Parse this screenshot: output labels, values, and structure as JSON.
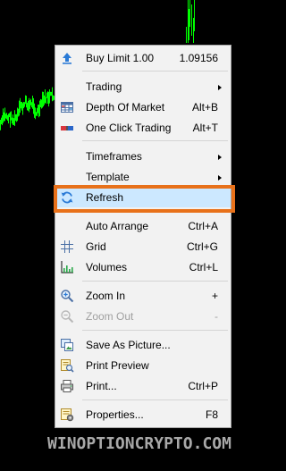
{
  "menu": {
    "items": [
      {
        "label": "Buy Limit 1.00",
        "shortcut": "1.09156",
        "icon": "buy-limit-icon",
        "submenu": false
      },
      {
        "label": "Trading",
        "shortcut": "",
        "icon": "",
        "submenu": true
      },
      {
        "label": "Depth Of Market",
        "shortcut": "Alt+B",
        "icon": "depth-of-market-icon",
        "submenu": false
      },
      {
        "label": "One Click Trading",
        "shortcut": "Alt+T",
        "icon": "one-click-trading-icon",
        "submenu": false
      },
      {
        "label": "Timeframes",
        "shortcut": "",
        "icon": "",
        "submenu": true
      },
      {
        "label": "Template",
        "shortcut": "",
        "icon": "",
        "submenu": true
      },
      {
        "label": "Refresh",
        "shortcut": "",
        "icon": "refresh-icon",
        "submenu": false
      },
      {
        "label": "Auto Arrange",
        "shortcut": "Ctrl+A",
        "icon": "",
        "submenu": false
      },
      {
        "label": "Grid",
        "shortcut": "Ctrl+G",
        "icon": "grid-icon",
        "submenu": false
      },
      {
        "label": "Volumes",
        "shortcut": "Ctrl+L",
        "icon": "volumes-icon",
        "submenu": false
      },
      {
        "label": "Zoom In",
        "shortcut": "+",
        "icon": "zoom-in-icon",
        "submenu": false
      },
      {
        "label": "Zoom Out",
        "shortcut": "-",
        "icon": "zoom-out-icon",
        "submenu": false,
        "disabled": true
      },
      {
        "label": "Save As Picture...",
        "shortcut": "",
        "icon": "save-picture-icon",
        "submenu": false
      },
      {
        "label": "Print Preview",
        "shortcut": "",
        "icon": "print-preview-icon",
        "submenu": false
      },
      {
        "label": "Print...",
        "shortcut": "Ctrl+P",
        "icon": "print-icon",
        "submenu": false
      },
      {
        "label": "Properties...",
        "shortcut": "F8",
        "icon": "properties-icon",
        "submenu": false
      }
    ],
    "highlighted": "Refresh"
  },
  "colors": {
    "chart_background": "#000000",
    "candles": "#00ff00",
    "menu_background": "#f2f2f2",
    "highlight": "#cce8ff",
    "callout_border": "#e8711a",
    "watermark": "#a8a8a8"
  },
  "watermark": "WINOPTIONCRYPTO.COM"
}
